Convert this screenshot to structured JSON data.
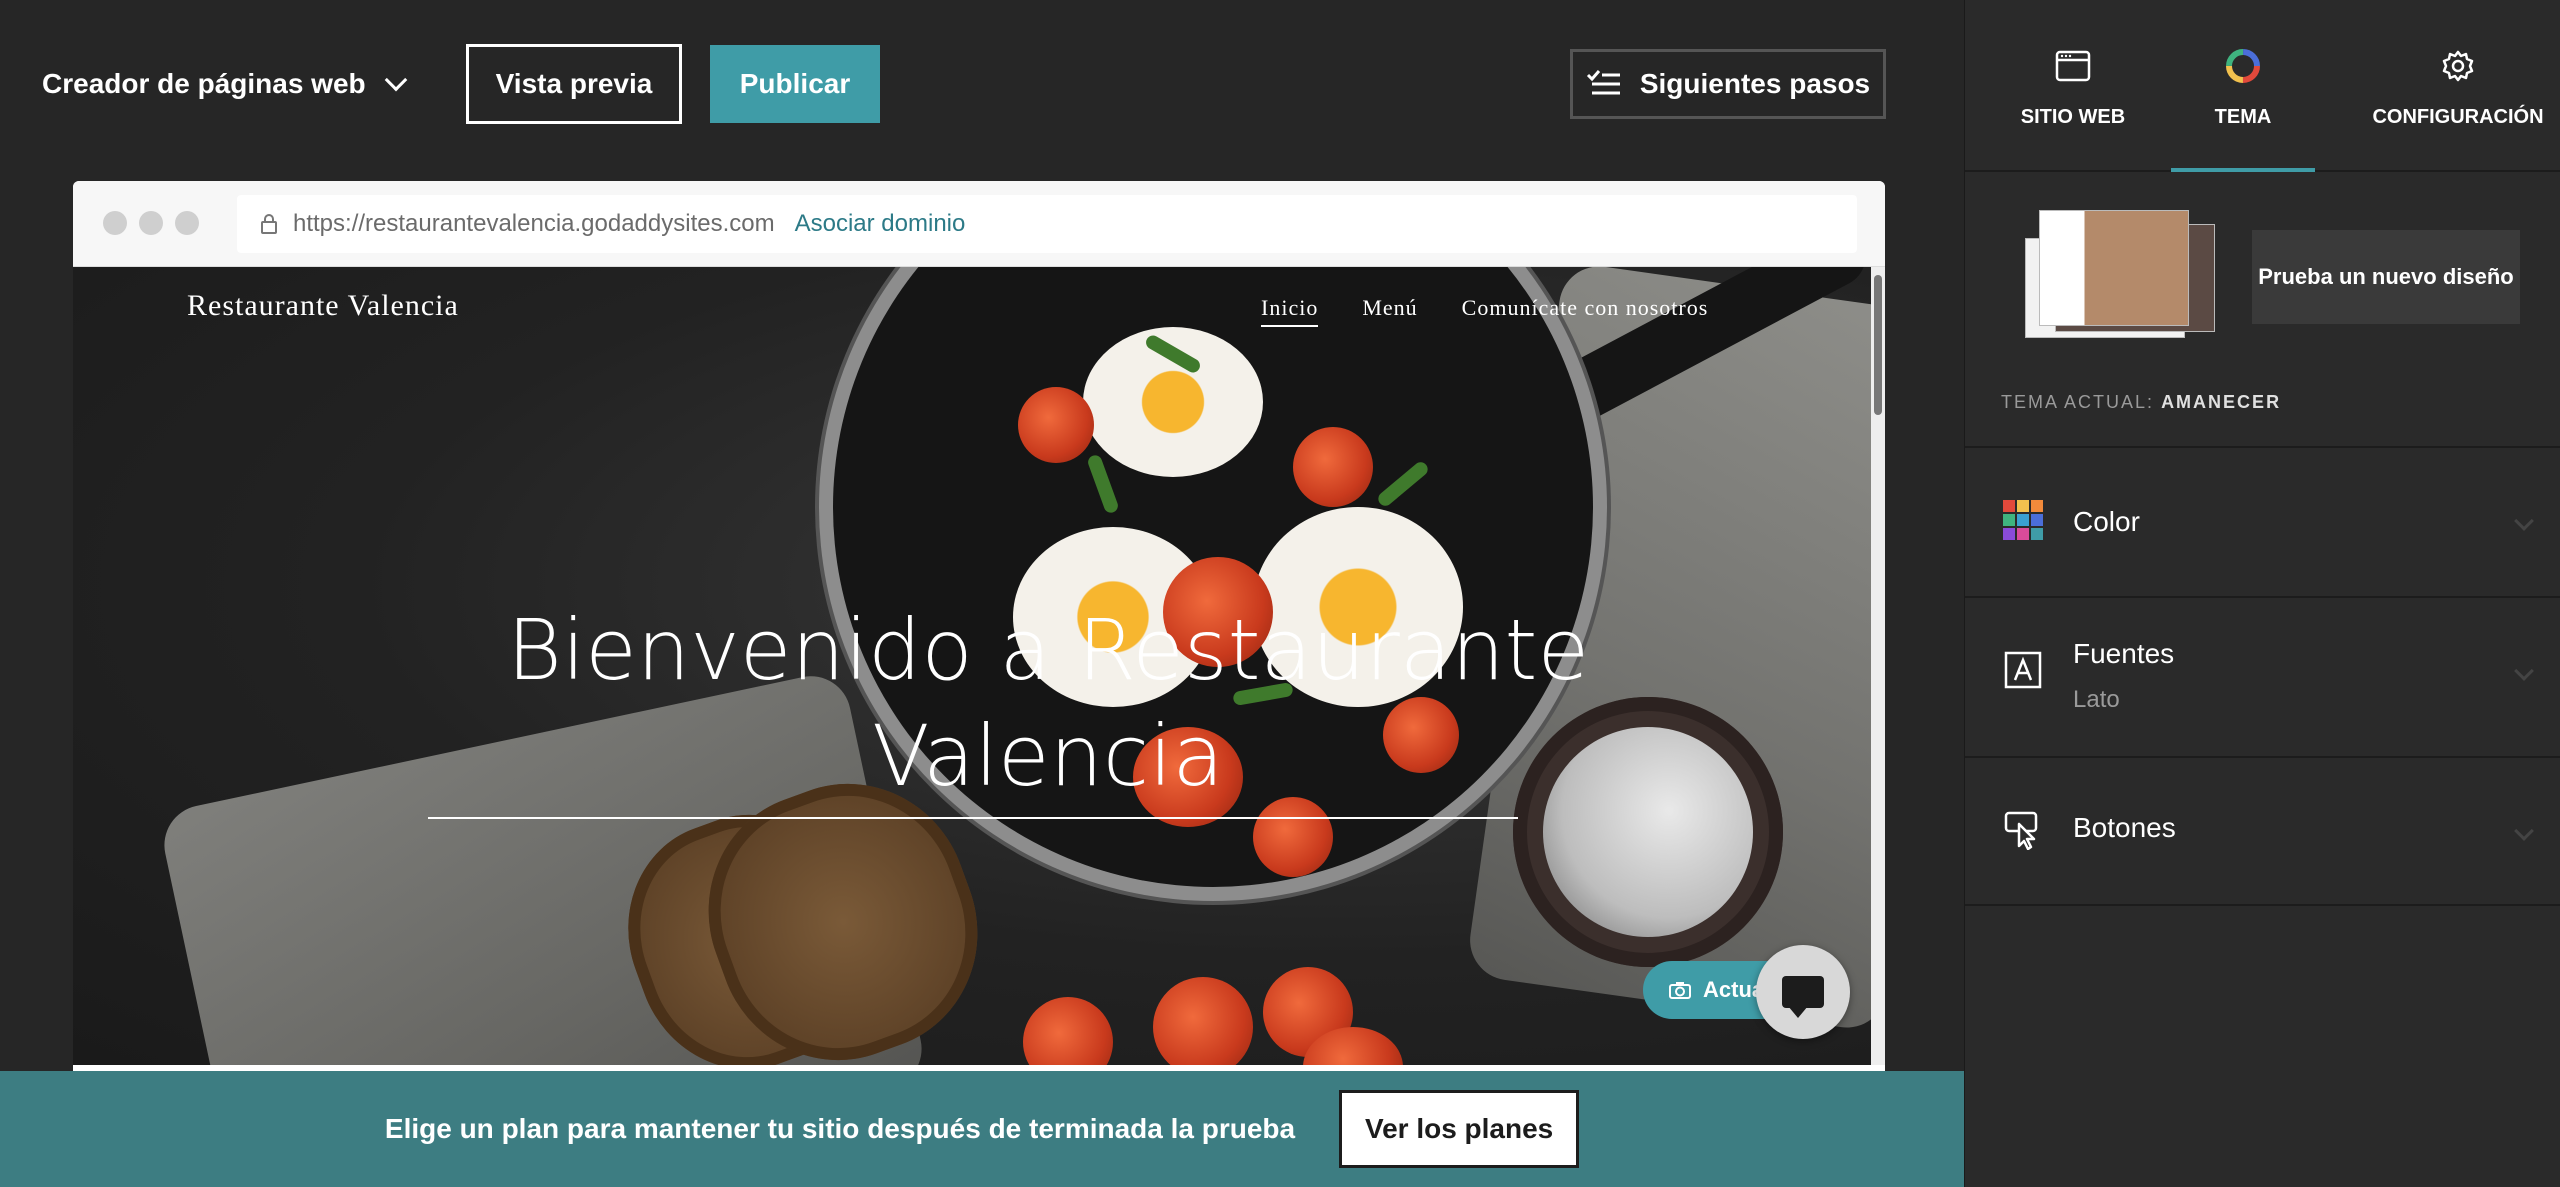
{
  "header": {
    "builder_title": "Creador de páginas web",
    "preview_label": "Vista previa",
    "publish_label": "Publicar",
    "next_steps_label": "Siguientes pasos"
  },
  "browser": {
    "url": "https://restaurantevalencia.godaddysites.com",
    "domain_link": "Asociar dominio"
  },
  "site": {
    "name": "Restaurante Valencia",
    "nav": [
      "Inicio",
      "Menú",
      "Comunícate con nosotros"
    ],
    "hero_title_line1": "Bienvenido a Restaurante",
    "hero_title_line2": "Valencia",
    "update_label": "Actua"
  },
  "banner": {
    "text": "Elige un plan para mantener tu sitio después de terminada la prueba",
    "button_label": "Ver los planes"
  },
  "panel": {
    "tabs": [
      {
        "label": "SITIO WEB",
        "icon": "browser-window-icon"
      },
      {
        "label": "TEMA",
        "icon": "color-wheel-icon",
        "active": true
      },
      {
        "label": "CONFIGURACIÓN",
        "icon": "gear-icon"
      }
    ],
    "try_design_label": "Prueba un nuevo diseño",
    "current_theme_prefix": "TEMA ACTUAL:",
    "current_theme_name": "AMANECER",
    "rows": [
      {
        "label": "Color",
        "icon": "color-grid-icon"
      },
      {
        "label": "Fuentes",
        "sub": "Lato",
        "icon": "font-icon"
      },
      {
        "label": "Botones",
        "icon": "button-pointer-icon"
      }
    ]
  },
  "colors": {
    "accent": "#3f9ca7",
    "banner": "#3d7d82",
    "background": "#262626",
    "panel": "#2a2a2a"
  }
}
